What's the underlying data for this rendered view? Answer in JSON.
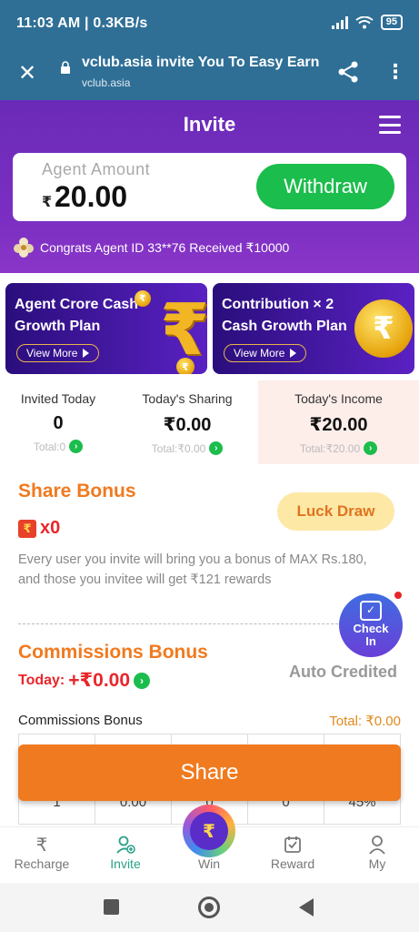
{
  "status_bar": {
    "time": "11:03 AM | 0.3KB/s",
    "battery": "95"
  },
  "browser": {
    "title": "vclub.asia invite You To Easy Earn...",
    "url": "vclub.asia"
  },
  "header": {
    "title": "Invite"
  },
  "agent": {
    "label": "Agent Amount",
    "currency": "₹",
    "amount": "20.00",
    "withdraw_label": "Withdraw"
  },
  "congrats": "Congrats Agent ID 33**76 Received ₹10000",
  "banners": [
    {
      "title": "Agent Crore Cash Growth Plan",
      "button": "View More"
    },
    {
      "title": "Contribution × 2 Cash Growth Plan",
      "button": "View More"
    }
  ],
  "stats": [
    {
      "label": "Invited Today",
      "value": "0",
      "total": "Total:0"
    },
    {
      "label": "Today's Sharing",
      "value": "₹0.00",
      "total": "Total:₹0.00"
    },
    {
      "label": "Today's Income",
      "value": "₹20.00",
      "total": "Total:₹20.00"
    }
  ],
  "share_bonus": {
    "title": "Share Bonus",
    "luck_draw": "Luck Draw",
    "count": "x0",
    "description": "Every user you invite will bring you a bonus of MAX Rs.180, and those you invitee will get ₹121 rewards"
  },
  "check_in": {
    "label_line1": "Check",
    "label_line2": "In"
  },
  "commissions": {
    "title": "Commissions Bonus",
    "today_label": "Today:",
    "today_amount": "+₹0.00",
    "auto_credited": "Auto Credited",
    "table_label": "Commissions Bonus",
    "total": "Total: ₹0.00",
    "row_values": [
      "1",
      "0.00",
      "0",
      "0",
      "45%"
    ]
  },
  "share_button": "Share",
  "tabs": [
    {
      "label": "Recharge",
      "icon": "rupee-icon"
    },
    {
      "label": "Invite",
      "icon": "add-user-icon"
    },
    {
      "label": "Win",
      "icon": "coin-icon"
    },
    {
      "label": "Reward",
      "icon": "reward-icon"
    },
    {
      "label": "My",
      "icon": "user-icon"
    }
  ],
  "colors": {
    "brand_purple": "#6b2ab8",
    "orange": "#f07a1f",
    "green": "#1bbd4c",
    "active_tab": "#2aa188"
  }
}
